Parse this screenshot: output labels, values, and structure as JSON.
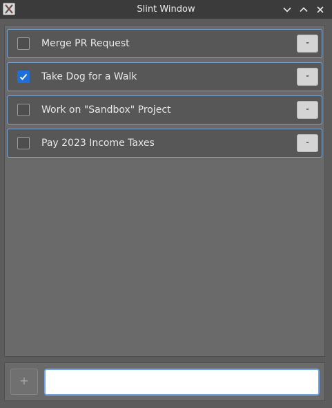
{
  "window": {
    "title": "Slint Window",
    "icon": "x-app-icon",
    "controls": [
      "chevron-down-icon",
      "chevron-up-icon",
      "close-icon"
    ]
  },
  "todos": [
    {
      "label": "Merge PR Request",
      "checked": false,
      "remove_label": "-"
    },
    {
      "label": "Take Dog for a Walk",
      "checked": true,
      "remove_label": "-"
    },
    {
      "label": "Work on \"Sandbox\" Project",
      "checked": false,
      "remove_label": "-"
    },
    {
      "label": "Pay 2023 Income Taxes",
      "checked": false,
      "remove_label": "-"
    }
  ],
  "footer": {
    "add_label": "+",
    "input_value": "",
    "input_placeholder": ""
  },
  "colors": {
    "accent": "#1e6fd9",
    "row_border": "#7aa1d2",
    "input_border": "#6ea6ee"
  }
}
